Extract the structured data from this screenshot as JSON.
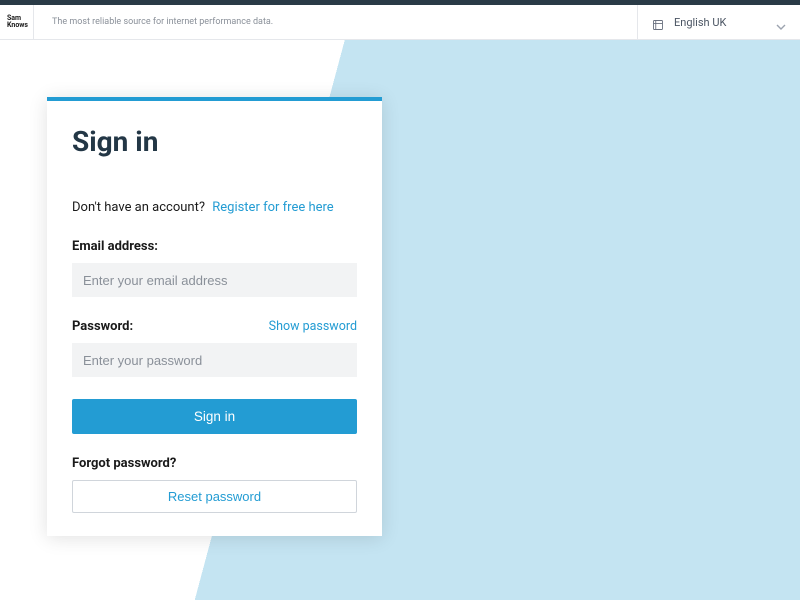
{
  "header": {
    "logo_line1": "Sam",
    "logo_line2": "Knows",
    "tagline": "The most reliable source for internet performance data.",
    "language": "English UK"
  },
  "card": {
    "title": "Sign in",
    "no_account_text": "Don't have an account?",
    "register_link": "Register for free here",
    "email_label": "Email address:",
    "email_placeholder": "Enter your email address",
    "password_label": "Password:",
    "show_password": "Show password",
    "password_placeholder": "Enter your password",
    "signin_button": "Sign in",
    "forgot_label": "Forgot password?",
    "reset_button": "Reset password"
  }
}
